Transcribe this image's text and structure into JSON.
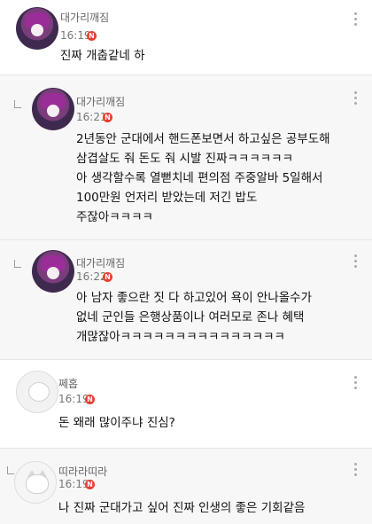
{
  "comments": [
    {
      "nickname": "대가리깨짐",
      "time": "16:19",
      "badge": "N",
      "text": "진짜 개춥같네 하",
      "avatar": "purple-doll-avatar",
      "reply": false
    },
    {
      "nickname": "대가리깨짐",
      "time": "16:21",
      "badge": "N",
      "text": "2년동안 군대에서 핸드폰보면서 하고싶은 공부도해\n삼겹살도 줘 돈도 줘 시발 진짜ㅋㅋㅋㅋㅋㅋ\n아 생각할수록 열뻗치네 편의점 주중알바 5일해서\n100만원 언저리 받았는데 저긴 밥도\n주잖아ㅋㅋㅋㅋ",
      "avatar": "purple-doll-avatar",
      "reply": true
    },
    {
      "nickname": "대가리깨짐",
      "time": "16:22",
      "badge": "N",
      "text": "아 남자 좋으란 짓 다 하고있어 욕이 안나올수가\n없네 군인들 은행상품이나 여러모로 존나 혜택\n개많잖아ㅋㅋㅋㅋㅋㅋㅋㅋㅋㅋㅋㅋㅋㅋㅋ",
      "avatar": "purple-doll-avatar",
      "reply": true
    },
    {
      "nickname": "쩨홉",
      "time": "16:19",
      "badge": "N",
      "text": "돈 왜래 많이주냐 진심?",
      "avatar": "sheep-avatar",
      "reply": false
    },
    {
      "nickname": "띠라라띠라",
      "time": "16:19",
      "badge": "N",
      "text": "나 진짜 군대가고 싶어 진짜 인생의 좋은 기회같음",
      "avatar": "cat-avatar",
      "reply": true
    }
  ]
}
